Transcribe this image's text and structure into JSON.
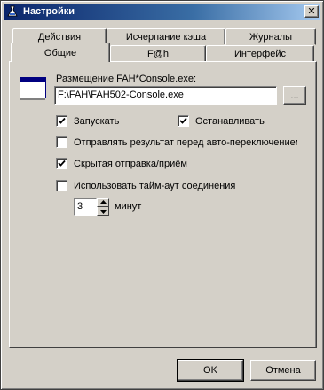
{
  "window": {
    "title": "Настройки",
    "close_glyph": "✕"
  },
  "tabs": {
    "row_back": [
      "Действия",
      "Исчерпание кэша",
      "Журналы"
    ],
    "row_front": [
      "Общие",
      "F@h",
      "Интерфейс"
    ],
    "active": "Общие"
  },
  "general": {
    "path_label": "Размещение FAH*Console.exe:",
    "path_value": "F:\\FAH\\FAH502-Console.exe",
    "browse_label": "...",
    "options": [
      {
        "label": "Запускать",
        "checked": true
      },
      {
        "label": "Останавливать",
        "checked": true
      },
      {
        "label": "Отправлять результат перед авто-переключением",
        "checked": false
      },
      {
        "label": "Скрытая отправка/приём",
        "checked": true
      },
      {
        "label": "Использовать тайм-аут соединения",
        "checked": false
      }
    ],
    "timeout_value": "3",
    "timeout_unit": "минут"
  },
  "footer": {
    "ok_label": "OK",
    "cancel_label": "Отмена"
  }
}
